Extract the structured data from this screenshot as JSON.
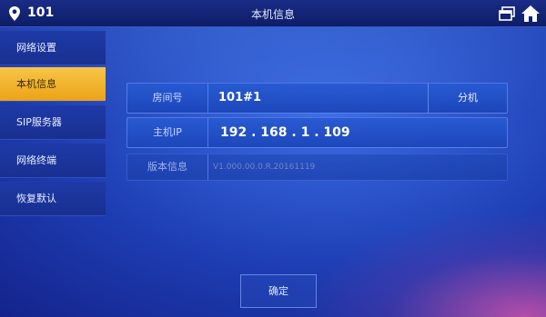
{
  "header": {
    "room_number": "101",
    "title": "本机信息",
    "pin_icon": "location-pin-icon",
    "window_icon": "window-icon",
    "home_icon": "home-icon"
  },
  "sidebar": {
    "items": [
      {
        "label": "网络设置",
        "active": false
      },
      {
        "label": "本机信息",
        "active": true
      },
      {
        "label": "SIP服务器",
        "active": false
      },
      {
        "label": "网络终端",
        "active": false
      },
      {
        "label": "恢复默认",
        "active": false
      }
    ]
  },
  "info": {
    "room": {
      "label": "房间号",
      "value": "101#1",
      "button": "分机"
    },
    "ip": {
      "label": "主机IP",
      "value": "192 . 168 . 1 . 109"
    },
    "version": {
      "label": "版本信息",
      "value": "V1.000.00.0.R.20161119"
    }
  },
  "confirm_label": "确定",
  "colors": {
    "active_tab": "#f0b22a",
    "sidebar": "#1f3aa8",
    "background": "#2a55d0",
    "accent_bottom_right": "#be50aa"
  }
}
